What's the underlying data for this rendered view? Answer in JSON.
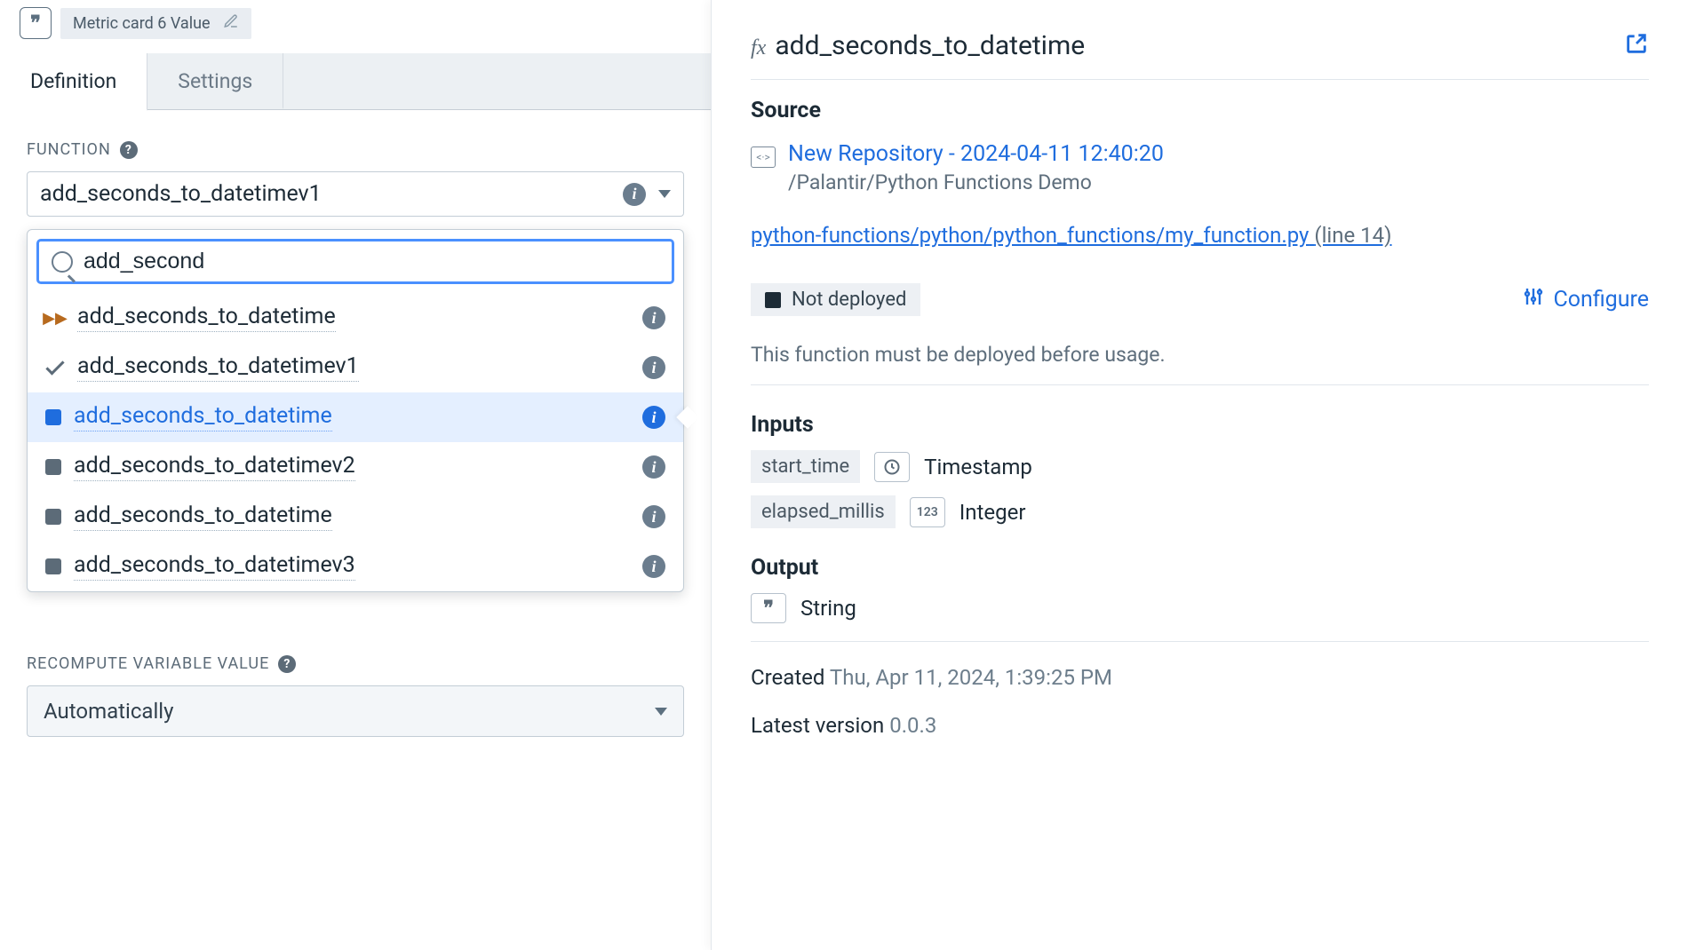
{
  "breadcrumb": {
    "title": "Metric card 6 Value"
  },
  "tabs": {
    "definition": "Definition",
    "settings": "Settings"
  },
  "function_section": {
    "label": "FUNCTION",
    "selected": "add_seconds_to_datetimev1",
    "search_value": "add_second",
    "options": [
      {
        "label": "add_seconds_to_datetime",
        "icon": "ff",
        "info": "gray"
      },
      {
        "label": "add_seconds_to_datetimev1",
        "icon": "check",
        "info": "gray"
      },
      {
        "label": "add_seconds_to_datetime",
        "icon": "stop-blue",
        "info": "blue",
        "selected": true
      },
      {
        "label": "add_seconds_to_datetimev2",
        "icon": "stop",
        "info": "gray"
      },
      {
        "label": "add_seconds_to_datetime",
        "icon": "stop",
        "info": "gray"
      },
      {
        "label": "add_seconds_to_datetimev3",
        "icon": "stop",
        "info": "gray"
      }
    ]
  },
  "recompute": {
    "label": "RECOMPUTE VARIABLE VALUE",
    "value": "Automatically"
  },
  "detail": {
    "title": "add_seconds_to_datetime",
    "source_heading": "Source",
    "repo_name": "New Repository - 2024-04-11 12:40:20",
    "repo_path": "/Palantir/Python Functions Demo",
    "file_link": "python-functions/python/python_functions/my_function.py",
    "file_line": "(line 14)",
    "deploy_status": "Not deployed",
    "configure": "Configure",
    "deploy_note": "This function must be deployed before usage.",
    "inputs_heading": "Inputs",
    "inputs": [
      {
        "name": "start_time",
        "type": "Timestamp",
        "icon": "clock"
      },
      {
        "name": "elapsed_millis",
        "type": "Integer",
        "icon": "123"
      }
    ],
    "output_heading": "Output",
    "output_type": "String",
    "created_label": "Created",
    "created_value": "Thu, Apr 11, 2024, 1:39:25 PM",
    "version_label": "Latest version",
    "version_value": "0.0.3"
  }
}
